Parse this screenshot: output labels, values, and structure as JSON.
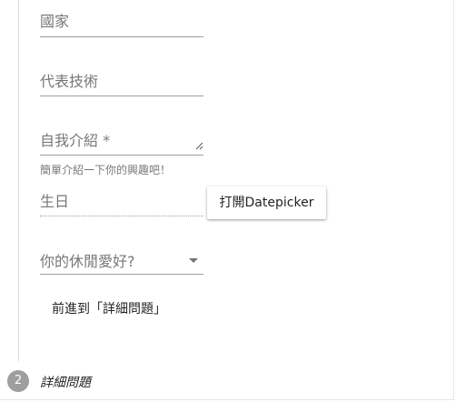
{
  "form": {
    "country": {
      "placeholder": "國家"
    },
    "skill": {
      "placeholder": "代表技術"
    },
    "intro": {
      "placeholder": "自我介紹 *",
      "hint": "簡單介紹一下你的興趣吧！"
    },
    "birthday": {
      "placeholder": "生日"
    },
    "datepicker_button": "打開Datepicker",
    "hobby": {
      "placeholder": "你的休閒愛好?"
    },
    "next_button": "前進到「詳細問題」"
  },
  "stepper": {
    "step2": {
      "number": "2",
      "label": "詳細問題"
    }
  },
  "colors": {
    "underline": "#9e9e9e",
    "step_inactive": "#9e9e9e",
    "divider": "#dcdcdc"
  }
}
